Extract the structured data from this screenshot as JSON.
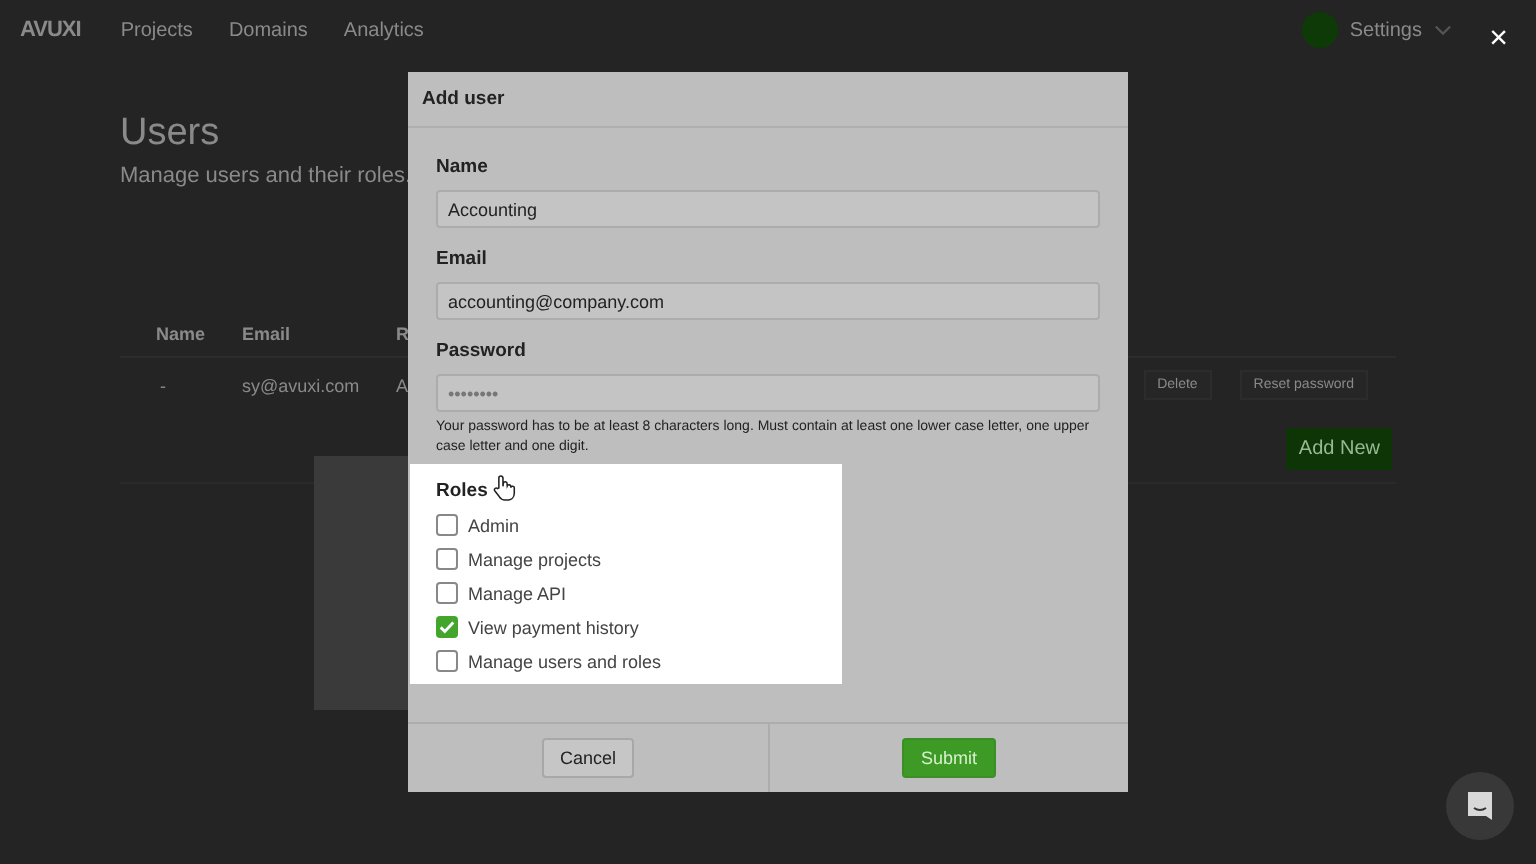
{
  "header": {
    "logo": "AVUXI",
    "nav": [
      {
        "label": "Projects"
      },
      {
        "label": "Domains"
      },
      {
        "label": "Analytics"
      }
    ],
    "settings": "Settings"
  },
  "page": {
    "title": "Users",
    "subtitle": "Manage users and their roles.",
    "table": {
      "columns": [
        "Name",
        "Email",
        "R"
      ],
      "rows": [
        {
          "cells": [
            "-",
            "sy@avuxi.com",
            "A"
          ],
          "actions": [
            "Delete",
            "Reset password"
          ]
        }
      ]
    },
    "add_button": "Add New"
  },
  "dialog": {
    "title": "Add user",
    "fields": [
      {
        "label": "Name",
        "value": "Accounting"
      },
      {
        "label": "Email",
        "value": "accounting@company.com"
      },
      {
        "label": "Password",
        "placeholder": "••••••••"
      }
    ],
    "hint": "Your password has to be at least 8 characters long. Must contain at least one lower case letter, one upper case letter and one digit.",
    "roles_label": "Roles",
    "roles": [
      {
        "label": "Admin",
        "checked": false
      },
      {
        "label": "Manage projects",
        "checked": false
      },
      {
        "label": "Manage API",
        "checked": false
      },
      {
        "label": "View payment history",
        "checked": true
      },
      {
        "label": "Manage users and roles",
        "checked": false
      }
    ],
    "cancel": "Cancel",
    "submit": "Submit"
  },
  "close": "×"
}
